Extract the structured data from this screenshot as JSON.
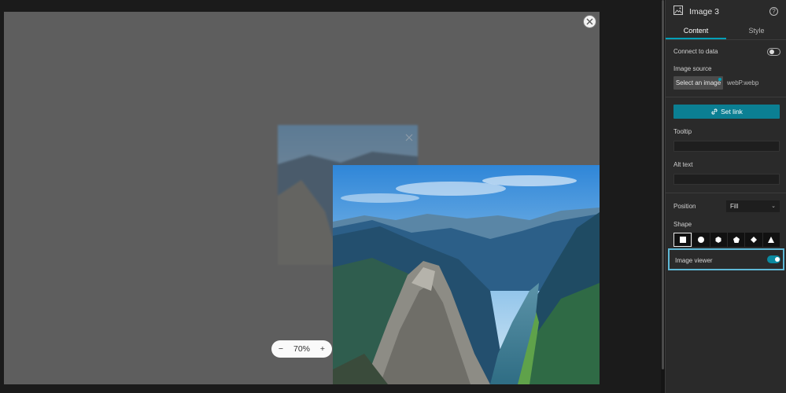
{
  "canvas": {
    "zoom": {
      "level": "70%",
      "minus": "−",
      "plus": "+"
    }
  },
  "panel": {
    "title": "Image 3",
    "help_glyph": "?",
    "tabs": [
      {
        "label": "Content",
        "active": true
      },
      {
        "label": "Style",
        "active": false
      }
    ],
    "connect_to_data": {
      "label": "Connect to data",
      "enabled": false
    },
    "image_source": {
      "label": "Image source",
      "button": "Select an image",
      "file": "webP.webp"
    },
    "set_link": {
      "label": "Set link"
    },
    "tooltip": {
      "label": "Tooltip",
      "value": ""
    },
    "alt_text": {
      "label": "Alt text",
      "value": ""
    },
    "position": {
      "label": "Position",
      "value": "Fill",
      "chevron": "⌄"
    },
    "shape": {
      "label": "Shape",
      "options": [
        "square",
        "circle",
        "hexagon",
        "pentagon",
        "diamond",
        "triangle"
      ],
      "selected": "square"
    },
    "image_viewer": {
      "label": "Image viewer",
      "enabled": true
    }
  },
  "colors": {
    "accent": "#0b7f93",
    "highlight": "#5fb8d6",
    "panel_bg": "#2a2a2a",
    "viewer_bg": "#5e5e5e"
  }
}
